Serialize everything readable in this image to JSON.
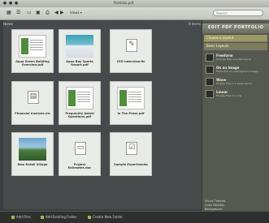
{
  "window": {
    "title": "Portfolio.pdf"
  },
  "toolbar": {
    "view_label": "Views ▾",
    "search_placeholder": "Search"
  },
  "main": {
    "breadcrumb": "Home",
    "count": "9 items",
    "files": [
      {
        "name": "Aqua Green Building Overview.pdf",
        "thumb": "doc"
      },
      {
        "name": "Aqua Bay Sports Resort.pdf",
        "thumb": "photo2"
      },
      {
        "name": "CEO Interview.flv",
        "thumb": "icon"
      },
      {
        "name": "Financial Analysis.xls",
        "thumb": "icon"
      },
      {
        "name": "Frequently Asked Questions.pdf",
        "thumb": "doc"
      },
      {
        "name": "In The Press.pdf",
        "thumb": "doc"
      },
      {
        "name": "New Retail Village",
        "thumb": "photo"
      },
      {
        "name": "Project Estimates.doc",
        "thumb": "icon"
      },
      {
        "name": "Sample Experiments",
        "thumb": "icon"
      }
    ]
  },
  "panel": {
    "title": "EDIT PDF PORTFOLIO",
    "section_layouts": "Choose a Layout",
    "section_basic": "Basic Layouts",
    "layouts": [
      {
        "name": "Freeform",
        "desc": "Arrange files on a flat layout"
      },
      {
        "name": "On an Image",
        "desc": "Place files on a background image"
      },
      {
        "name": "Wave",
        "desc": "Display files in a wave layout"
      },
      {
        "name": "Linear",
        "desc": "Display files in a row"
      }
    ],
    "footer": [
      "Visual Themes",
      "Color Palettes",
      "Background"
    ]
  },
  "status": {
    "items": [
      "Add Files",
      "Add Existing Folder",
      "Create New Folder"
    ]
  }
}
